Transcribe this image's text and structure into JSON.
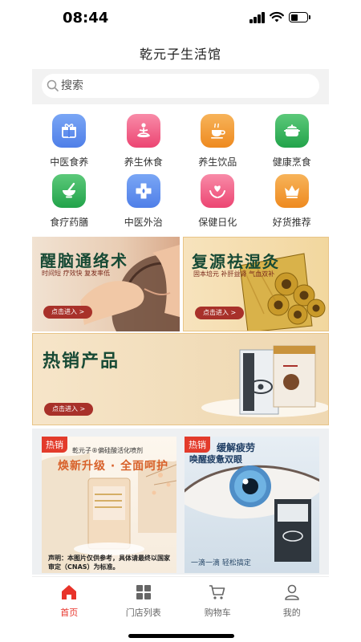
{
  "status_bar": {
    "time": "08:44"
  },
  "header": {
    "title": "乾元子生活馆"
  },
  "search": {
    "placeholder": "搜索"
  },
  "categories": [
    {
      "label": "中医食养",
      "icon": "gift-icon",
      "color": "#5b8def"
    },
    {
      "label": "养生休食",
      "icon": "meditation-icon",
      "color": "#f0567f"
    },
    {
      "label": "养生饮品",
      "icon": "tea-cup-icon",
      "color": "#f39a2c"
    },
    {
      "label": "健康烹食",
      "icon": "pot-icon",
      "color": "#35b35a"
    },
    {
      "label": "食疗药膳",
      "icon": "mortar-icon",
      "color": "#35b35a"
    },
    {
      "label": "中医外治",
      "icon": "medical-cross-icon",
      "color": "#5b8def"
    },
    {
      "label": "保健日化",
      "icon": "hands-heart-icon",
      "color": "#f0567f"
    },
    {
      "label": "好货推荐",
      "icon": "crown-icon",
      "color": "#f39a2c"
    }
  ],
  "banners": {
    "b1": {
      "title": "醒脑通络术",
      "subtitle": "时间短 疗效快 复发率低",
      "button": "点击进入 >"
    },
    "b2": {
      "title": "复源祛湿灸",
      "subtitle": "固本培元 补肝益肾 气血双补",
      "button": "点击进入 >"
    },
    "b3": {
      "title": "热销产品",
      "button": "点击进入 >"
    }
  },
  "products": [
    {
      "badge": "热销",
      "brand_line": "乾元子®偏硅酸活化喷剂",
      "headline": "焕新升级 · 全面呵护",
      "disclaimer": "声明：本图片仅供参考，具体请最终以国家审定（CNAS）为标准。"
    },
    {
      "badge": "热销",
      "headline": "缓解疲劳",
      "headline2": "唤醒疲惫双眼",
      "footer": "一滴一滴 轻松搞定"
    }
  ],
  "tabs": [
    {
      "label": "首页",
      "icon": "home-icon",
      "active": true
    },
    {
      "label": "门店列表",
      "icon": "grid-icon",
      "active": false
    },
    {
      "label": "购物车",
      "icon": "cart-icon",
      "active": false
    },
    {
      "label": "我的",
      "icon": "user-icon",
      "active": false
    }
  ],
  "colors": {
    "accent": "#e8332a",
    "banner_title": "#174a35",
    "button": "#a8312a"
  }
}
